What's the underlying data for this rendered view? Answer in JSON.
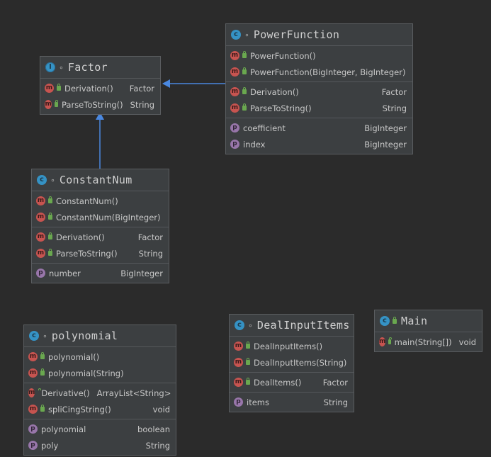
{
  "classes": {
    "factor": {
      "name": "Factor",
      "methods": [
        {
          "name": "Derivation()",
          "type": "Factor"
        },
        {
          "name": "ParseToString()",
          "type": "String"
        }
      ]
    },
    "powerfunction": {
      "name": "PowerFunction",
      "constructors": [
        {
          "name": "PowerFunction()"
        },
        {
          "name": "PowerFunction(BigInteger, BigInteger)"
        }
      ],
      "methods": [
        {
          "name": "Derivation()",
          "type": "Factor"
        },
        {
          "name": "ParseToString()",
          "type": "String"
        }
      ],
      "fields": [
        {
          "name": "coefficient",
          "type": "BigInteger"
        },
        {
          "name": "index",
          "type": "BigInteger"
        }
      ]
    },
    "constantnum": {
      "name": "ConstantNum",
      "constructors": [
        {
          "name": "ConstantNum()"
        },
        {
          "name": "ConstantNum(BigInteger)"
        }
      ],
      "methods": [
        {
          "name": "Derivation()",
          "type": "Factor"
        },
        {
          "name": "ParseToString()",
          "type": "String"
        }
      ],
      "fields": [
        {
          "name": "number",
          "type": "BigInteger"
        }
      ]
    },
    "polynomial": {
      "name": "polynomial",
      "constructors": [
        {
          "name": "polynomial()"
        },
        {
          "name": "polynomial(String)"
        }
      ],
      "methods": [
        {
          "name": "Derivative()",
          "type": "ArrayList<String>"
        },
        {
          "name": "spliCingString()",
          "type": "void"
        }
      ],
      "fields": [
        {
          "name": "polynomial",
          "type": "boolean"
        },
        {
          "name": "poly",
          "type": "String"
        }
      ]
    },
    "dealinputitems": {
      "name": "DealInputItems",
      "constructors": [
        {
          "name": "DealInputItems()"
        },
        {
          "name": "DealInputItems(String)"
        }
      ],
      "methods": [
        {
          "name": "DealItems()",
          "type": "Factor"
        }
      ],
      "fields": [
        {
          "name": "items",
          "type": "String"
        }
      ]
    },
    "main": {
      "name": "Main",
      "methods": [
        {
          "name": "main(String[])",
          "type": "void"
        }
      ]
    }
  },
  "icons": {
    "class": "class-icon",
    "interface": "interface-icon",
    "method": "method-icon",
    "field": "field-icon",
    "public": "public-lock-icon"
  },
  "colors": {
    "background": "#2b2b2b",
    "panel": "#3c3f41",
    "edge": "#4a88e0",
    "class_badge": "#3592c4",
    "method_badge": "#c75450",
    "field_badge": "#9876aa",
    "public_lock": "#6aa84f"
  }
}
